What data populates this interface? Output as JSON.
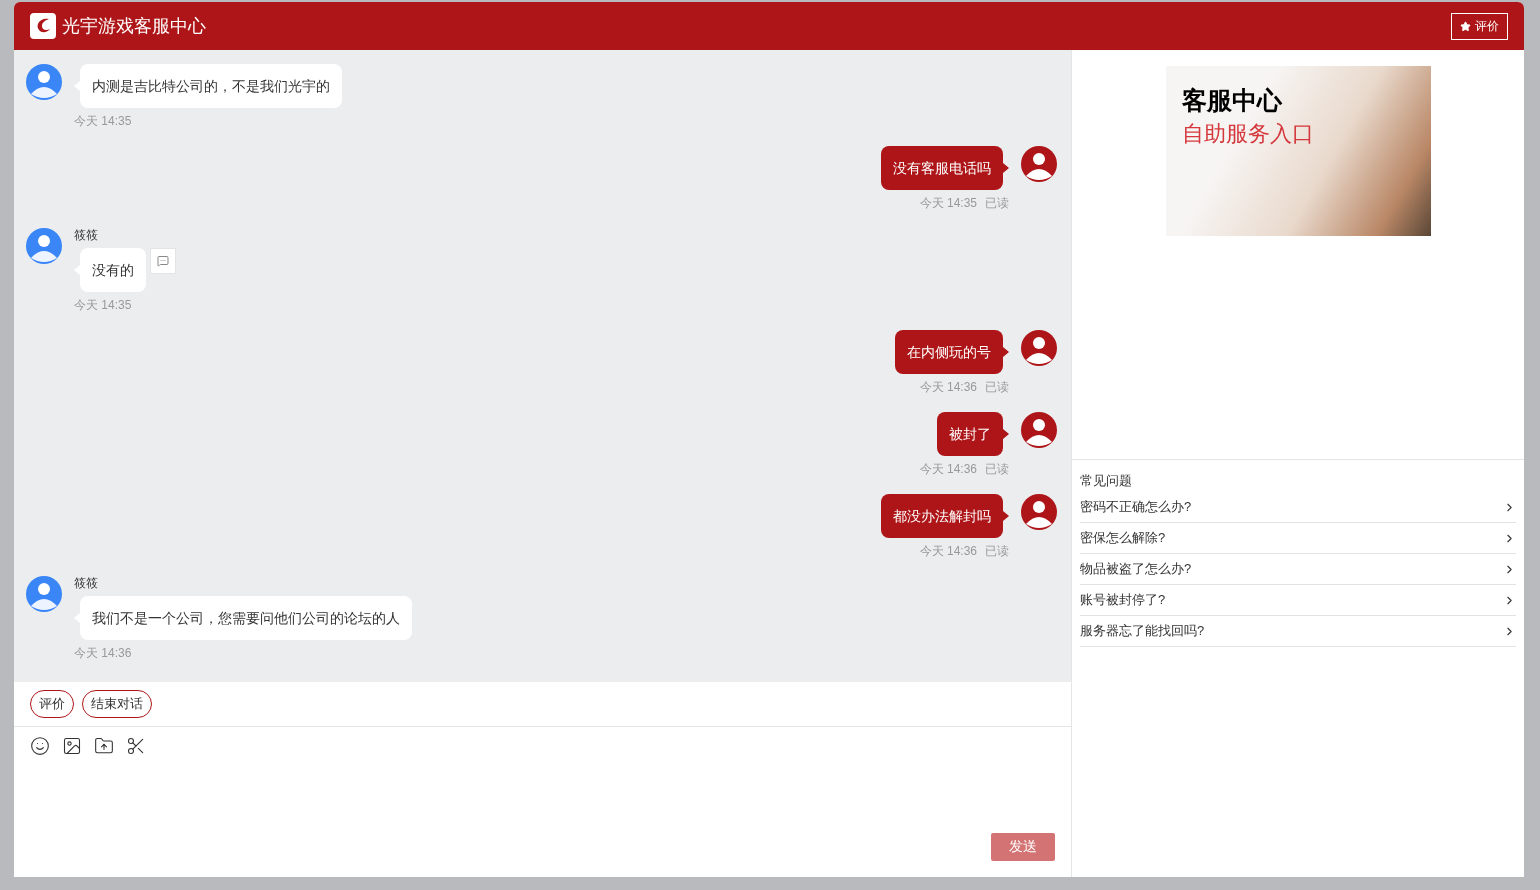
{
  "header": {
    "title": "光宇游戏客服中心",
    "rate_button": "评价"
  },
  "messages": [
    {
      "kind": "agent",
      "text": "内测是吉比特公司的，不是我们光宇的",
      "time": "今天 14:35",
      "note": false
    },
    {
      "kind": "user",
      "text": "没有客服电话吗",
      "time": "今天 14:35",
      "status": "已读"
    },
    {
      "kind": "agent",
      "sender": "筱筱",
      "text": "没有的",
      "time": "今天 14:35",
      "note": true
    },
    {
      "kind": "user",
      "text": "在内侧玩的号",
      "time": "今天 14:36",
      "status": "已读"
    },
    {
      "kind": "user",
      "text": "被封了",
      "time": "今天 14:36",
      "status": "已读"
    },
    {
      "kind": "user",
      "text": "都没办法解封吗",
      "time": "今天 14:36",
      "status": "已读"
    },
    {
      "kind": "agent",
      "sender": "筱筱",
      "text": "我们不是一个公司，您需要问他们公司的论坛的人",
      "time": "今天 14:36",
      "note": false
    }
  ],
  "quick_actions": [
    "评价",
    "结束对话"
  ],
  "send_button": "发送",
  "banner": {
    "title": "客服中心",
    "subtitle": "自助服务入口"
  },
  "faq": {
    "title": "常见问题",
    "items": [
      "密码不正确怎么办?",
      "密保怎么解除?",
      "物品被盗了怎么办?",
      "账号被封停了?",
      "服务器忘了能找回吗?"
    ]
  }
}
